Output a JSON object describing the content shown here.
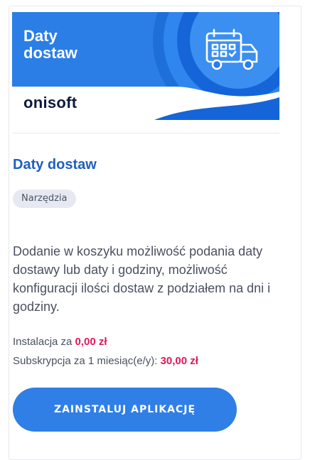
{
  "banner": {
    "title_line1": "Daty",
    "title_line2": "dostaw",
    "logo_text": "onisoft",
    "icon": "delivery-truck-calendar-icon",
    "color_blue": "#2a7ee6",
    "color_dark_blue": "#1565d8"
  },
  "app": {
    "name": "Daty dostaw",
    "category": "Narzędzia",
    "description": "Dodanie w koszyku możliwość podania daty dostawy lub daty i godziny, możliwość konfiguracji ilości dostaw z podziałem na dni i godziny."
  },
  "pricing": {
    "install_label": "Instalacja za ",
    "install_price": "0,00 zł",
    "subscription_label": "Subskrypcja za 1 miesiąc(e/y): ",
    "subscription_price": "30,00 zł",
    "price_color": "#e3165b"
  },
  "actions": {
    "install_button": "ZAINSTALUJ APLIKACJĘ"
  }
}
